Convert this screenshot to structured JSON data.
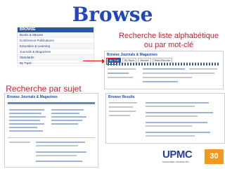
{
  "title": "Browse",
  "captions": {
    "alpha": "Recherche liste alphabétique ou par mot-clé",
    "subject": "Recherche par sujet"
  },
  "browse_menu": {
    "header": "BROWSE",
    "items": [
      "Books & eBooks",
      "Conference Publications",
      "Education & Learning",
      "Journals & Magazines",
      "Standards",
      "By Topic"
    ]
  },
  "shot1": {
    "heading": "Browse Journals & Magazines",
    "tabs": [
      "By Title",
      "By Topic",
      "Recent",
      "Most Popular"
    ]
  },
  "shot2": {
    "heading": "Browse Journals & Magazines"
  },
  "shot3": {
    "heading": "Browse Results"
  },
  "logos": {
    "upmc": "UPMC",
    "upmc_sub": "SORBONNE UNIVERSITÉS",
    "orange": "30"
  },
  "colors": {
    "title": "#2148b5",
    "caption": "#c8222e",
    "accent": "#2957a4",
    "highlight": "#e02020"
  }
}
